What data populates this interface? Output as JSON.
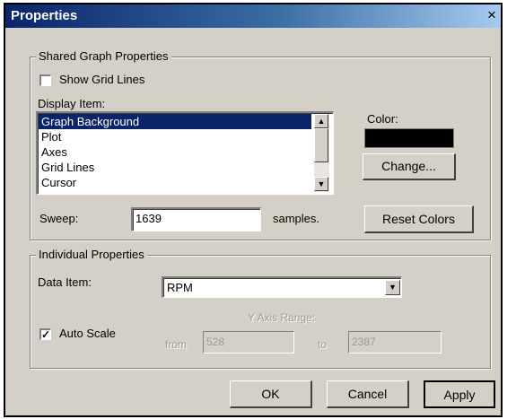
{
  "window": {
    "title": "Properties",
    "close_glyph": "×"
  },
  "shared": {
    "group_label": "Shared Graph Properties",
    "show_grid_lines_label": "Show Grid Lines",
    "show_grid_lines_checked": false,
    "display_item_label": "Display Item:",
    "display_items": [
      "Graph Background",
      "Plot",
      "Axes",
      "Grid Lines",
      "Cursor"
    ],
    "selected_display_item": "Graph Background",
    "color_label": "Color:",
    "color_value": "#000000",
    "change_button": "Change...",
    "sweep_label": "Sweep:",
    "sweep_value": "1639",
    "sweep_units": "samples.",
    "reset_colors_button": "Reset Colors"
  },
  "individual": {
    "group_label": "Individual Properties",
    "data_item_label": "Data Item:",
    "data_item_value": "RPM",
    "auto_scale_label": "Auto Scale",
    "auto_scale_checked": true,
    "check_glyph": "✓",
    "y_axis_range_label": "Y Axis Range:",
    "from_label": "from",
    "from_value": "528",
    "to_label": "to",
    "to_value": "2387"
  },
  "buttons": {
    "ok": "OK",
    "cancel": "Cancel",
    "apply": "Apply"
  }
}
